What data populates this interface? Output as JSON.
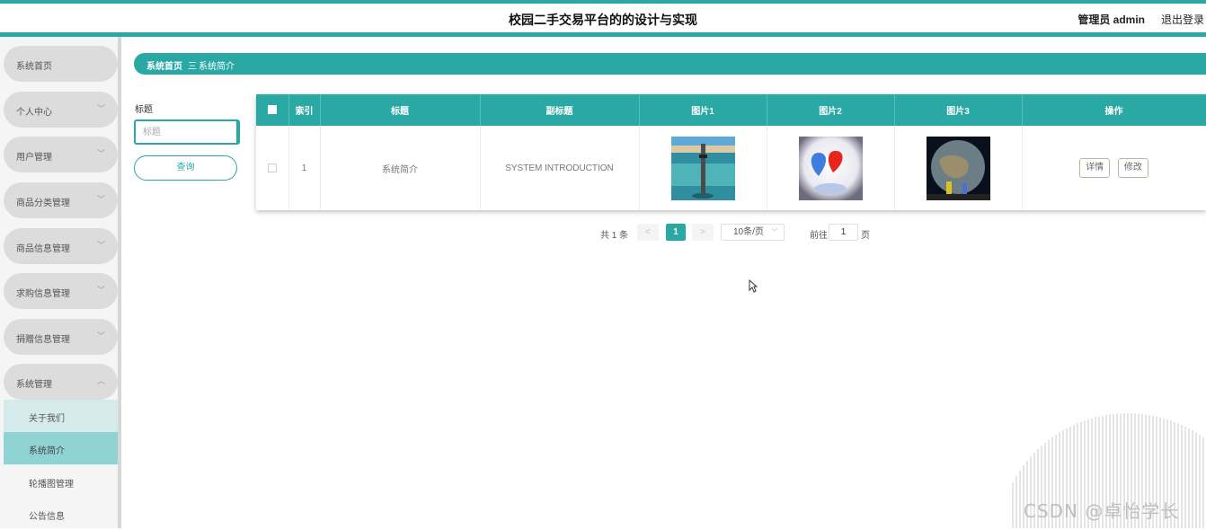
{
  "header": {
    "title": "校园二手交易平台的的设计与实现",
    "user": "管理员 admin",
    "logout": "退出登录"
  },
  "sidebar": {
    "items": [
      {
        "label": "系统首页",
        "chevron": ""
      },
      {
        "label": "个人中心",
        "chevron": "﹀"
      },
      {
        "label": "用户管理",
        "chevron": "﹀"
      },
      {
        "label": "商品分类管理",
        "chevron": "﹀"
      },
      {
        "label": "商品信息管理",
        "chevron": "﹀"
      },
      {
        "label": "求购信息管理",
        "chevron": "﹀"
      },
      {
        "label": "捐赠信息管理",
        "chevron": "﹀"
      },
      {
        "label": "系统管理",
        "chevron": "︿"
      }
    ],
    "sub_items": [
      "关于我们",
      "系统简介",
      "轮播图管理",
      "公告信息"
    ]
  },
  "breadcrumb": {
    "home": "系统首页",
    "separator": "三",
    "current": "系统简介"
  },
  "search": {
    "label": "标题",
    "placeholder": "标题",
    "button": "查询"
  },
  "table": {
    "headers": [
      "索引",
      "标题",
      "副标题",
      "图片1",
      "图片2",
      "图片3",
      "操作"
    ],
    "rows": [
      {
        "index": "1",
        "title": "系统简介",
        "subtitle": "SYSTEM INTRODUCTION",
        "pic1": "lighthouse-sea-image",
        "pic2": "balloon-hearts-image",
        "pic3": "earth-couple-image",
        "detail": "详情",
        "edit": "修改"
      }
    ]
  },
  "pagination": {
    "total": "共 1 条",
    "prev": "<",
    "current_page": "1",
    "next": ">",
    "page_size": "10条/页",
    "goto_label": "前往",
    "goto_value": "1",
    "page_suffix": "页"
  },
  "watermark": "CSDN @卓怡学长",
  "colors": {
    "accent": "#2aa8a4",
    "sidebar_bg": "#f5f5f5",
    "menu_item_bg": "#dcdcdc",
    "sub_active_bg": "#8fd3d4"
  }
}
